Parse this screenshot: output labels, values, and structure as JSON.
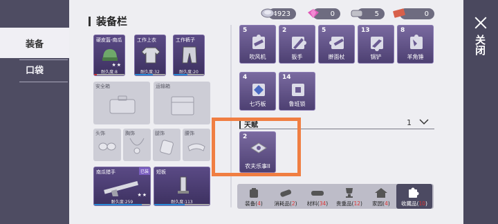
{
  "nav": {
    "items": [
      {
        "label": "装备",
        "active": true
      },
      {
        "label": "口袋",
        "active": false
      }
    ]
  },
  "currencies": [
    {
      "icon": "coin-icon",
      "value": "54923",
      "color": "#b8b8c8"
    },
    {
      "icon": "gem-icon",
      "value": "0",
      "color": "#e05ab8"
    },
    {
      "icon": "stone-icon",
      "value": "5",
      "color": "#aaa"
    },
    {
      "icon": "ticket-icon",
      "value": "0",
      "color": "#d8604a"
    }
  ],
  "close": {
    "label": "关闭"
  },
  "equipment": {
    "title": "装备栏",
    "slots": [
      {
        "label": "硬皮盔-南瓜",
        "durability": "耐久度:8",
        "stars": "★★",
        "filled": true
      },
      {
        "label": "工作上衣",
        "durability": "耐久度:32",
        "filled": true
      },
      {
        "label": "工作裤子",
        "durability": "耐久度:20",
        "filled": true
      },
      {
        "label": "安全箱",
        "filled": false
      },
      {
        "label": "运输箱",
        "filled": false
      },
      {
        "label": "头饰",
        "filled": false
      },
      {
        "label": "胸饰",
        "filled": false
      },
      {
        "label": "腿饰",
        "filled": false
      },
      {
        "label": "腰饰",
        "filled": false
      },
      {
        "label": "南瓜猎手",
        "durability": "耐久度:259",
        "stars": "★★",
        "flag": "已装",
        "filled": true
      },
      {
        "label": "短板",
        "durability": "耐久度:113",
        "filled": true
      }
    ]
  },
  "items": [
    {
      "count": "5",
      "name": "吹风机"
    },
    {
      "count": "2",
      "name": "扳手"
    },
    {
      "count": "5",
      "name": "擀面杖"
    },
    {
      "count": "13",
      "name": "锅铲"
    },
    {
      "count": "8",
      "name": "羊角锤"
    },
    {
      "count": "4",
      "name": "七巧板"
    },
    {
      "count": "14",
      "name": "鲁班锁"
    }
  ],
  "talent": {
    "title": "天赋",
    "page": "1",
    "items": [
      {
        "count": "2",
        "name": "农夫乐事II"
      }
    ]
  },
  "tabs": [
    {
      "label": "装备",
      "count": "4",
      "active": false
    },
    {
      "label": "消耗品",
      "count": "2",
      "active": false
    },
    {
      "label": "材料",
      "count": "34",
      "active": false
    },
    {
      "label": "贵重品",
      "count": "12",
      "active": false
    },
    {
      "label": "家园",
      "count": "4",
      "active": false
    },
    {
      "label": "收藏品",
      "count": "10",
      "active": true
    }
  ]
}
